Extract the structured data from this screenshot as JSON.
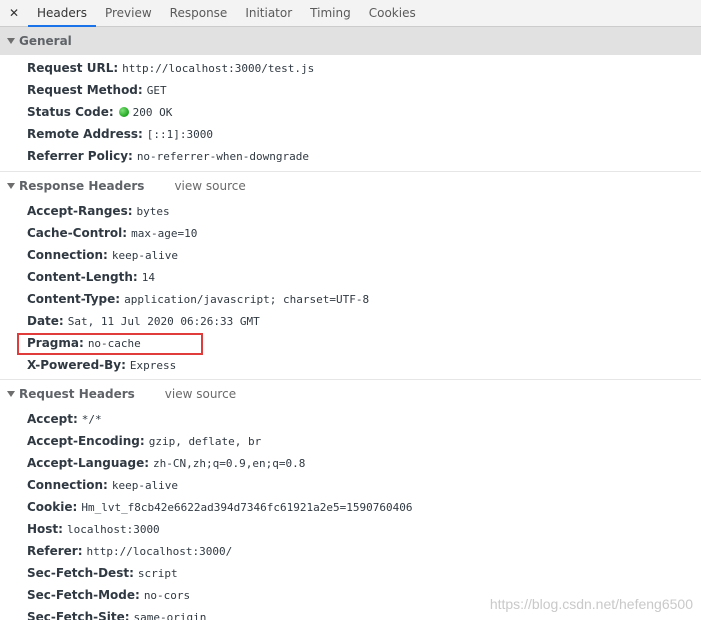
{
  "tabs": {
    "close_glyph": "✕",
    "items": [
      "Headers",
      "Preview",
      "Response",
      "Initiator",
      "Timing",
      "Cookies"
    ],
    "active": "Headers"
  },
  "general": {
    "title": "General",
    "rows": [
      {
        "key": "Request URL:",
        "value": "http://localhost:3000/test.js"
      },
      {
        "key": "Request Method:",
        "value": "GET"
      },
      {
        "key": "Status Code:",
        "value": "200 OK"
      },
      {
        "key": "Remote Address:",
        "value": "[::1]:3000"
      },
      {
        "key": "Referrer Policy:",
        "value": "no-referrer-when-downgrade"
      }
    ]
  },
  "response_headers": {
    "title": "Response Headers",
    "view_source": "view source",
    "rows": [
      {
        "key": "Accept-Ranges:",
        "value": "bytes"
      },
      {
        "key": "Cache-Control:",
        "value": "max-age=10"
      },
      {
        "key": "Connection:",
        "value": "keep-alive"
      },
      {
        "key": "Content-Length:",
        "value": "14"
      },
      {
        "key": "Content-Type:",
        "value": "application/javascript; charset=UTF-8"
      },
      {
        "key": "Date:",
        "value": "Sat, 11 Jul 2020 06:26:33 GMT"
      },
      {
        "key": "Pragma:",
        "value": "no-cache"
      },
      {
        "key": "X-Powered-By:",
        "value": "Express"
      }
    ]
  },
  "request_headers": {
    "title": "Request Headers",
    "view_source": "view source",
    "rows": [
      {
        "key": "Accept:",
        "value": "*/*"
      },
      {
        "key": "Accept-Encoding:",
        "value": "gzip, deflate, br"
      },
      {
        "key": "Accept-Language:",
        "value": "zh-CN,zh;q=0.9,en;q=0.8"
      },
      {
        "key": "Connection:",
        "value": "keep-alive"
      },
      {
        "key": "Cookie:",
        "value": "Hm_lvt_f8cb42e6622ad394d7346fc61921a2e5=1590760406"
      },
      {
        "key": "Host:",
        "value": "localhost:3000"
      },
      {
        "key": "Referer:",
        "value": "http://localhost:3000/"
      },
      {
        "key": "Sec-Fetch-Dest:",
        "value": "script"
      },
      {
        "key": "Sec-Fetch-Mode:",
        "value": "no-cors"
      },
      {
        "key": "Sec-Fetch-Site:",
        "value": "same-origin"
      }
    ]
  },
  "status_dot_color": "#1ea51e",
  "highlight_color": "#e03c3c",
  "watermark": "https://blog.csdn.net/hefeng6500"
}
